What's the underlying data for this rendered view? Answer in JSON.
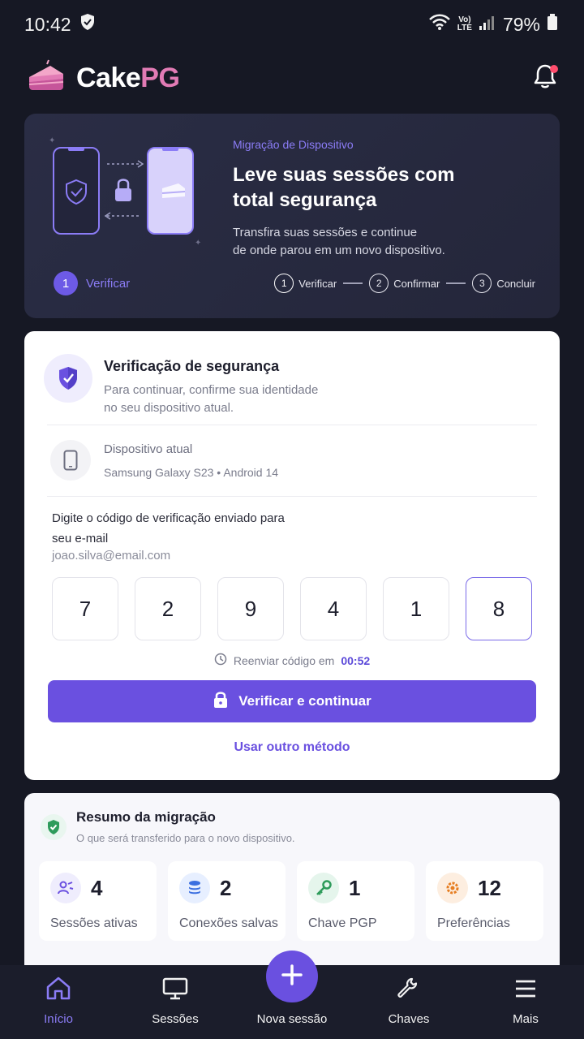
{
  "status_bar": {
    "time": "10:42",
    "battery": "79%",
    "network_top": "Vo)",
    "network_bottom": "LTE"
  },
  "header": {
    "brand_main": "Cake",
    "brand_accent": "PG"
  },
  "hero": {
    "kicker": "Migração de Dispositivo",
    "title_line1": "Leve suas sessões com",
    "title_line2": "total segurança",
    "subtitle_line1": "Transfira suas sessões e continue",
    "subtitle_line2": "de onde parou em um novo dispositivo.",
    "current_step_num": "1",
    "current_step_label": "Verificar",
    "steps": [
      {
        "num": "1",
        "label": "Verificar"
      },
      {
        "num": "2",
        "label": "Confirmar"
      },
      {
        "num": "3",
        "label": "Concluir"
      }
    ]
  },
  "verification": {
    "title": "Verificação de segurança",
    "subtitle_line1": "Para continuar, confirme sua identidade",
    "subtitle_line2": "no seu dispositivo atual.",
    "device_label": "Dispositivo atual",
    "device_model": "Samsung Galaxy S23 • Android 14",
    "prompt_line1": "Digite o código de verificação enviado para",
    "prompt_line2": "seu e-mail",
    "email": "joao.silva@email.com",
    "code": [
      "7",
      "2",
      "9",
      "4",
      "1",
      "8"
    ],
    "resend_text": "Reenviar código em",
    "resend_timer": "00:52",
    "primary_button": "Verificar e continuar",
    "alt_link": "Usar outro método"
  },
  "summary": {
    "title": "Resumo da migração",
    "subtitle": "O que será transferido para o novo dispositivo.",
    "stats": [
      {
        "value": "4",
        "label": "Sessões ativas",
        "color": "#6a50e0",
        "bg": "#efedfd"
      },
      {
        "value": "2",
        "label": "Conexões salvas",
        "color": "#3b6fe0",
        "bg": "#e7efff"
      },
      {
        "value": "1",
        "label": "Chave PGP",
        "color": "#2e9b5b",
        "bg": "#e5f5ec"
      },
      {
        "value": "12",
        "label": "Preferências",
        "color": "#e67e22",
        "bg": "#fdeee0"
      }
    ]
  },
  "nav": {
    "home": "Início",
    "sessions": "Sessões",
    "new_session": "Nova sessão",
    "keys": "Chaves",
    "more": "Mais"
  },
  "colors": {
    "accent": "#6a50e0",
    "background": "#161824",
    "brand_pink": "#e27bb5"
  }
}
